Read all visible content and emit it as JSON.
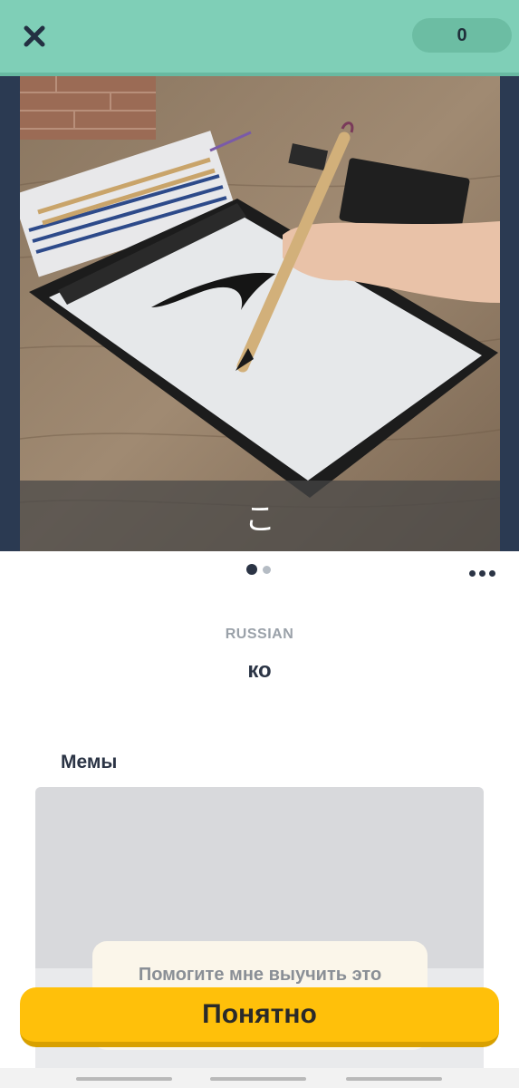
{
  "header": {
    "close_icon": "close-icon",
    "counter": "0"
  },
  "media": {
    "caption": "こ",
    "pager": {
      "total": 2,
      "active": 0
    }
  },
  "card": {
    "language": "RUSSIAN",
    "word": "ко"
  },
  "memes": {
    "title": "Мемы"
  },
  "help": {
    "text": "Помогите мне выучить это"
  },
  "actions": {
    "got_it": "Понятно"
  },
  "colors": {
    "header": "#7fcfb7",
    "button": "#ffc00a",
    "text_dark": "#2b3445"
  }
}
